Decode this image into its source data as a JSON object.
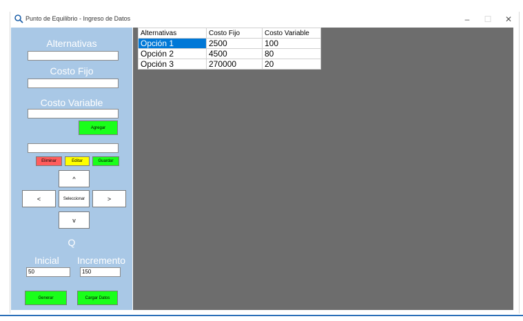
{
  "window": {
    "title": "Punto de Equilibrio - Ingreso de Datos",
    "controls": {
      "minimize": "–",
      "maximize": "☐",
      "close": "✕"
    }
  },
  "sidebar": {
    "alternativas_label": "Alternativas",
    "alternativas_value": "",
    "costo_fijo_label": "Costo Fijo",
    "costo_fijo_value": "",
    "costo_variable_label": "Costo Variable",
    "costo_variable_value": "",
    "agregar_label": "Agregar",
    "edit_value": "",
    "eliminar_label": "Eliminar",
    "editar_label": "Editar",
    "guardar_label": "Guardar",
    "up_label": "^",
    "left_label": "<",
    "seleccionar_label": "Seleccionar",
    "right_label": ">",
    "down_label": "v",
    "q_label": "Q",
    "inicial_label": "Inicial",
    "incremento_label": "Incremento",
    "inicial_value": "50",
    "incremento_value": "150",
    "generar_label": "Generar",
    "cargar_datos_label": "Cargar Datos"
  },
  "table": {
    "headers": [
      "Alternativas",
      "Costo Fijo",
      "Costo Variable"
    ],
    "rows": [
      [
        "Opción 1",
        "2500",
        "100"
      ],
      [
        "Opción 2",
        "4500",
        "80"
      ],
      [
        "Opción 3",
        "270000",
        "20"
      ]
    ],
    "selected_row": 0
  },
  "colors": {
    "sidebar_bg": "#a9c8e6",
    "grid_bg": "#6d6d6d",
    "selection": "#0078d7",
    "green": "#1aff1a",
    "red": "#ff5c5c",
    "yellow": "#ffff00"
  }
}
